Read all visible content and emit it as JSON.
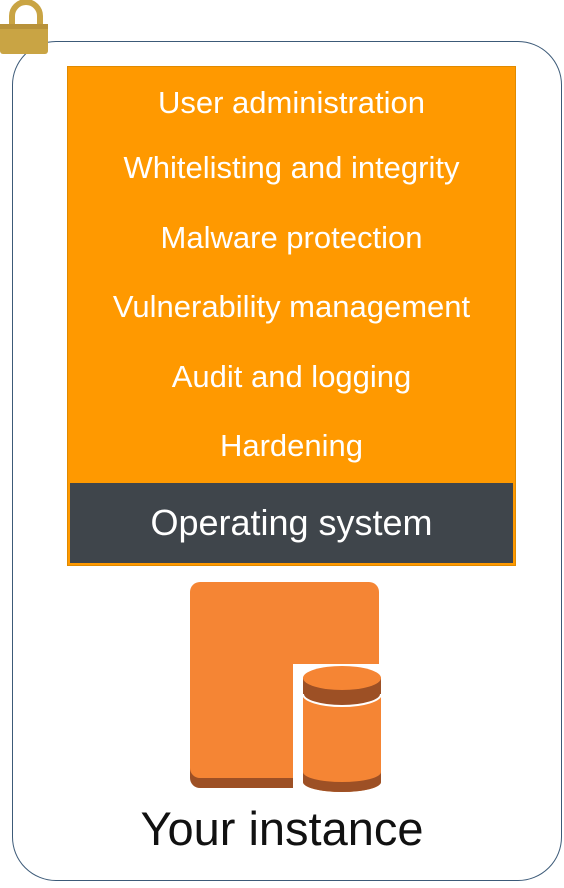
{
  "security_layers": [
    "User administration",
    "Whitelisting and integrity",
    "Malware protection",
    "Vulnerability management",
    "Audit and logging",
    "Hardening"
  ],
  "os_label": "Operating system",
  "instance_label": "Your instance",
  "icons": {
    "lock": "padlock-icon",
    "instance": "ec2-instance-icon"
  },
  "colors": {
    "layers_bg": "#ff9900",
    "os_bg": "#3f454b",
    "instance_orange": "#f58534",
    "instance_dark": "#9d5025",
    "lock": "#c9a444",
    "frame_border": "#3c5a78"
  }
}
